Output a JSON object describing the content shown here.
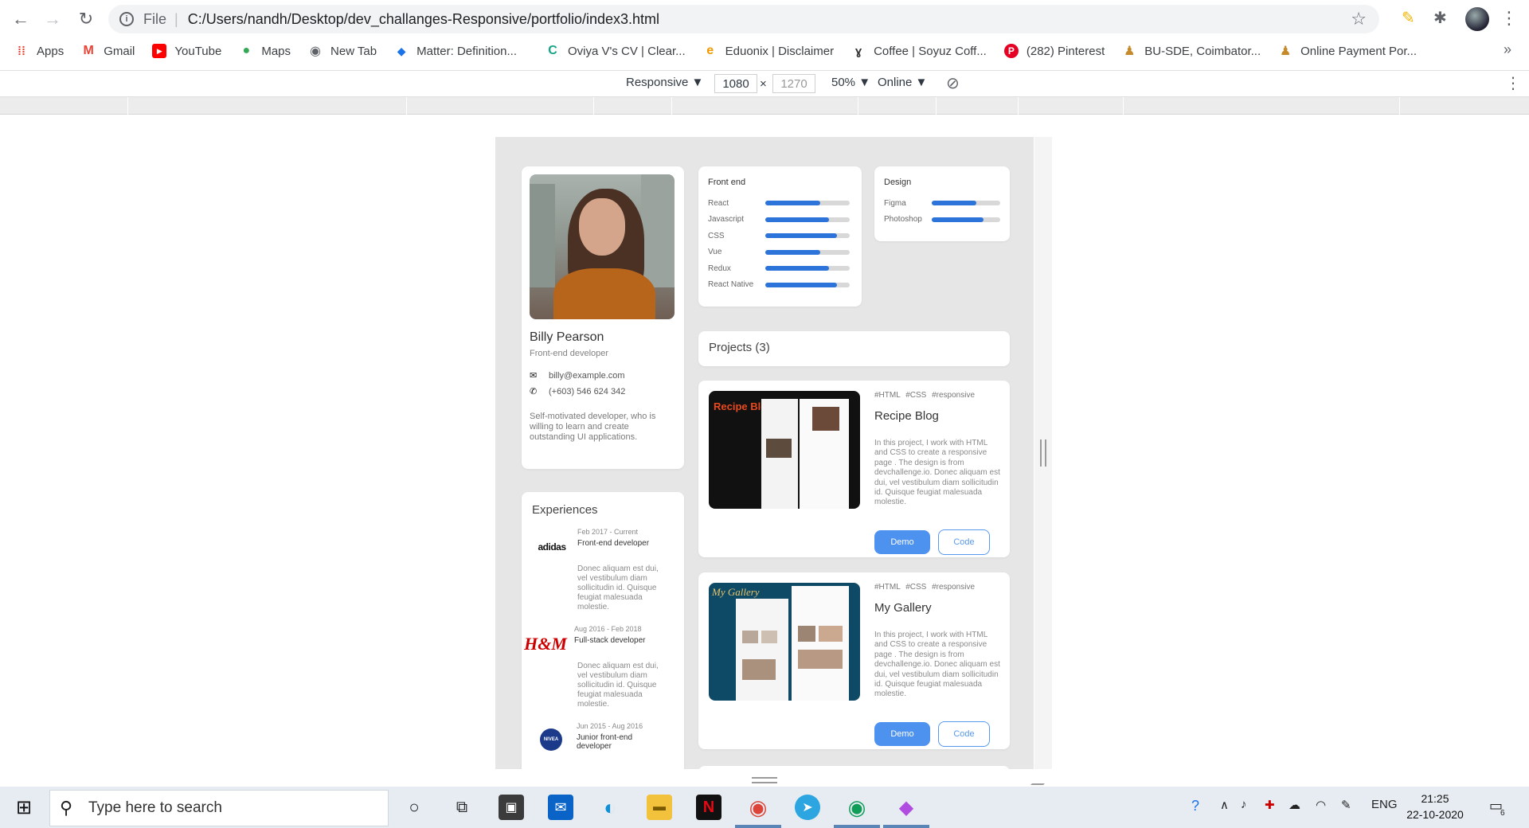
{
  "browser": {
    "file_label": "File",
    "url": "C:/Users/nandh/Desktop/dev_challanges-Responsive/portfolio/index3.html",
    "bookmarks": [
      {
        "label": "Apps",
        "color": "#ea4335"
      },
      {
        "label": "Gmail",
        "color": "#ea4335"
      },
      {
        "label": "YouTube",
        "color": "#ff0000"
      },
      {
        "label": "Maps",
        "color": "#34a853"
      },
      {
        "label": "New Tab",
        "color": "#5f6368"
      },
      {
        "label": "Matter: Definition...",
        "color": "#1a73e8"
      },
      {
        "label": "Oviya V's CV | Clear...",
        "color": "#17a589"
      },
      {
        "label": "Eduonix | Disclaimer",
        "color": "#f29900"
      },
      {
        "label": "Coffee | Soyuz Coff...",
        "color": "#333333"
      },
      {
        "label": "(282) Pinterest",
        "color": "#e60023"
      },
      {
        "label": "BU-SDE, Coimbator...",
        "color": "#c58a2b"
      },
      {
        "label": "Online Payment Por...",
        "color": "#c58a2b"
      }
    ]
  },
  "devtools": {
    "device": "Responsive ▼",
    "width": "1080",
    "times": "×",
    "height": "1270",
    "zoom": "50% ▼",
    "network": "Online ▼"
  },
  "profile": {
    "name": "Billy Pearson",
    "role": "Front-end developer",
    "email": "billy@example.com",
    "phone": "(+603) 546 624 342",
    "about": "Self-motivated developer, who is willing to learn and create outstanding UI applications."
  },
  "skills": {
    "frontend_title": "Front end",
    "frontend": [
      {
        "label": "React",
        "level": 0.65
      },
      {
        "label": "Javascript",
        "level": 0.75
      },
      {
        "label": "CSS",
        "level": 0.85
      },
      {
        "label": "Vue",
        "level": 0.65
      },
      {
        "label": "Redux",
        "level": 0.75
      },
      {
        "label": "React Native",
        "level": 0.85
      }
    ],
    "design_title": "Design",
    "design": [
      {
        "label": "Figma",
        "level": 0.65
      },
      {
        "label": "Photoshop",
        "level": 0.75
      }
    ]
  },
  "projects": {
    "header": "Projects (3)",
    "items": [
      {
        "tags": "#HTML #CSS #responsive",
        "title": "Recipe Blog",
        "thumb_title": "Recipe Blog",
        "desc": "In this project, I work with HTML and CSS to create a responsive page . The design is from devchallenge.io. Donec aliquam est dui, vel vestibulum diam sollicitudin id. Quisque feugiat malesuada molestie.",
        "demo": "Demo",
        "code": "Code"
      },
      {
        "tags": "#HTML #CSS #responsive",
        "title": "My Gallery",
        "thumb_title": "My Gallery",
        "desc": "In this project, I work with HTML and CSS to create a responsive page . The design is from devchallenge.io. Donec aliquam est dui, vel vestibulum diam sollicitudin id. Quisque feugiat malesuada molestie.",
        "demo": "Demo",
        "code": "Code"
      }
    ]
  },
  "experiences": {
    "title": "Experiences",
    "items": [
      {
        "logo": "adidas",
        "date": "Feb 2017 - Current",
        "title": "Front-end developer",
        "desc": "Donec aliquam est dui, vel vestibulum diam sollicitudin id. Quisque feugiat malesuada molestie."
      },
      {
        "logo": "H&M",
        "date": "Aug 2016 - Feb 2018",
        "title": "Full-stack developer",
        "desc": "Donec aliquam est dui, vel vestibulum diam sollicitudin id. Quisque feugiat malesuada molestie."
      },
      {
        "logo": "NIVEA",
        "date": "Jun 2015 - Aug 2016",
        "title": "Junior front-end developer",
        "desc": ""
      }
    ]
  },
  "taskbar": {
    "search_placeholder": "Type here to search",
    "lang": "ENG",
    "time": "21:25",
    "date": "22-10-2020",
    "notifications": "6"
  }
}
